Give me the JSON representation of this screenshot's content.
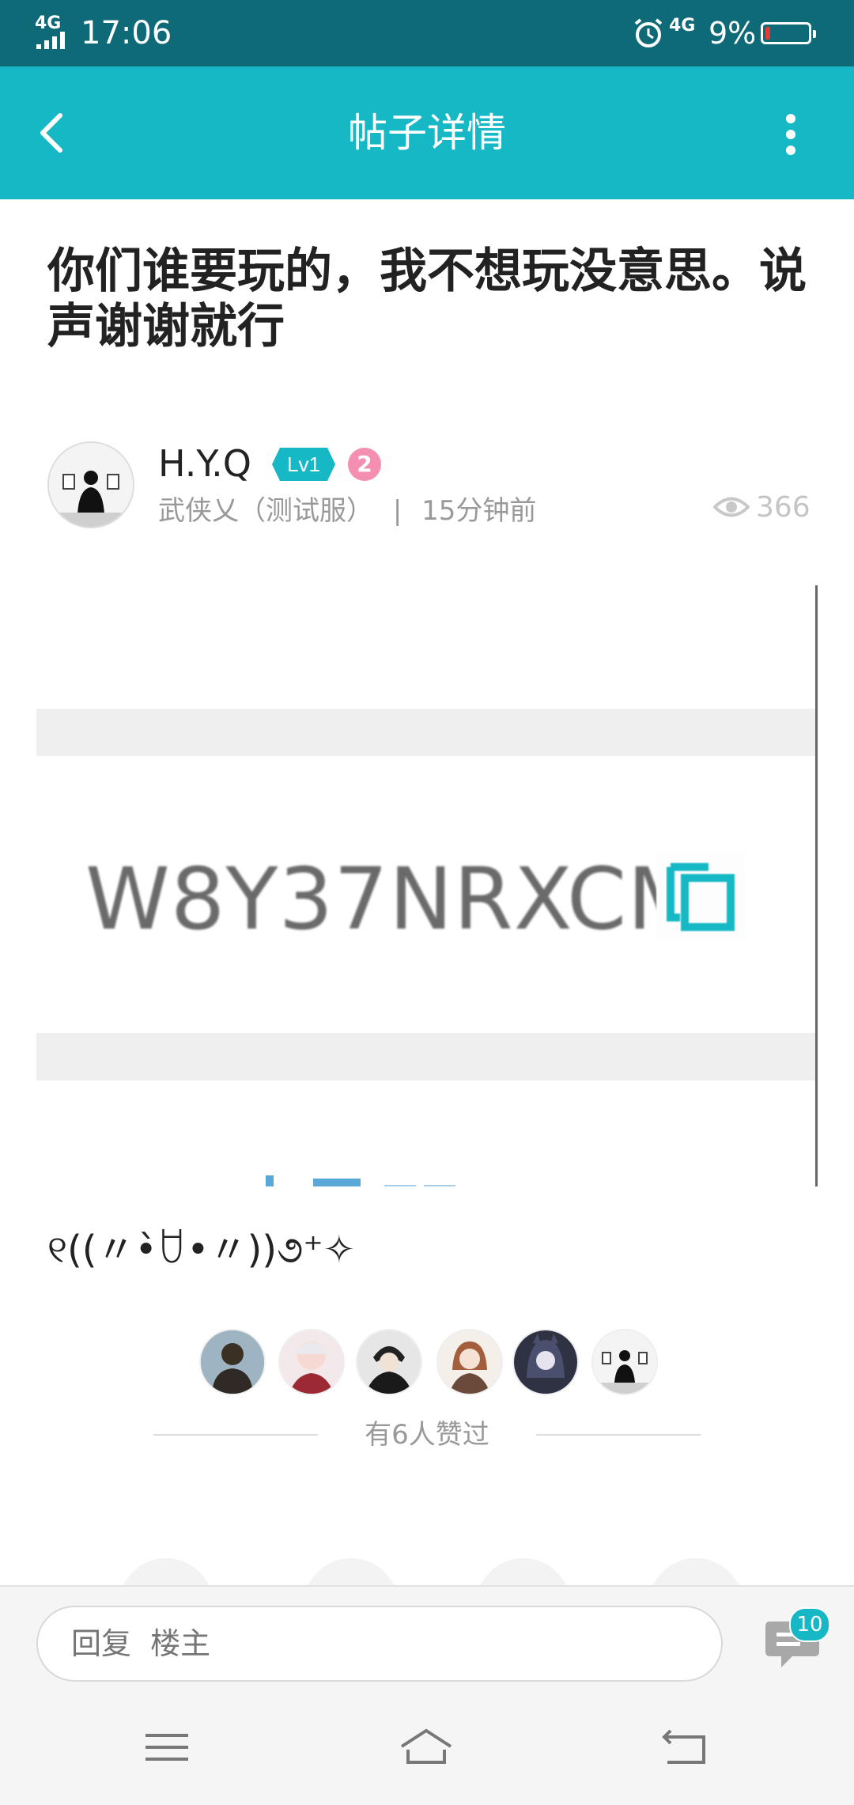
{
  "status_bar": {
    "network_left": "4G",
    "time": "17:06",
    "network_right": "4G",
    "battery": "9%",
    "icons": [
      "signal-icon",
      "alarm-icon",
      "battery-icon"
    ]
  },
  "app_bar": {
    "title": "帖子详情",
    "back_icon": "chevron-left-icon",
    "more_icon": "more-vertical-icon"
  },
  "post": {
    "title": "你们谁要玩的，我不想玩没意思。说声谢谢就行",
    "author": {
      "name": "H.Y.Q",
      "level": "Lv1",
      "rank": "2"
    },
    "forum": "武侠乂（测试服）",
    "separator": "|",
    "time_ago": "15分钟前",
    "views": "366",
    "image": {
      "code": "W8Y37NRXCM",
      "copy_icon": "copy-icon"
    },
    "body": "୧((〃•̀ꇴ•〃))૭⁺✧"
  },
  "likes": {
    "count": 6,
    "text": "有6人赞过"
  },
  "reply_bar": {
    "placeholder": "回复  楼主",
    "comment_count": "10"
  },
  "colors": {
    "status_bar": "#0f6a78",
    "accent": "#16b8c6",
    "rank_badge": "#f48fb1",
    "muted_text": "#999999"
  }
}
